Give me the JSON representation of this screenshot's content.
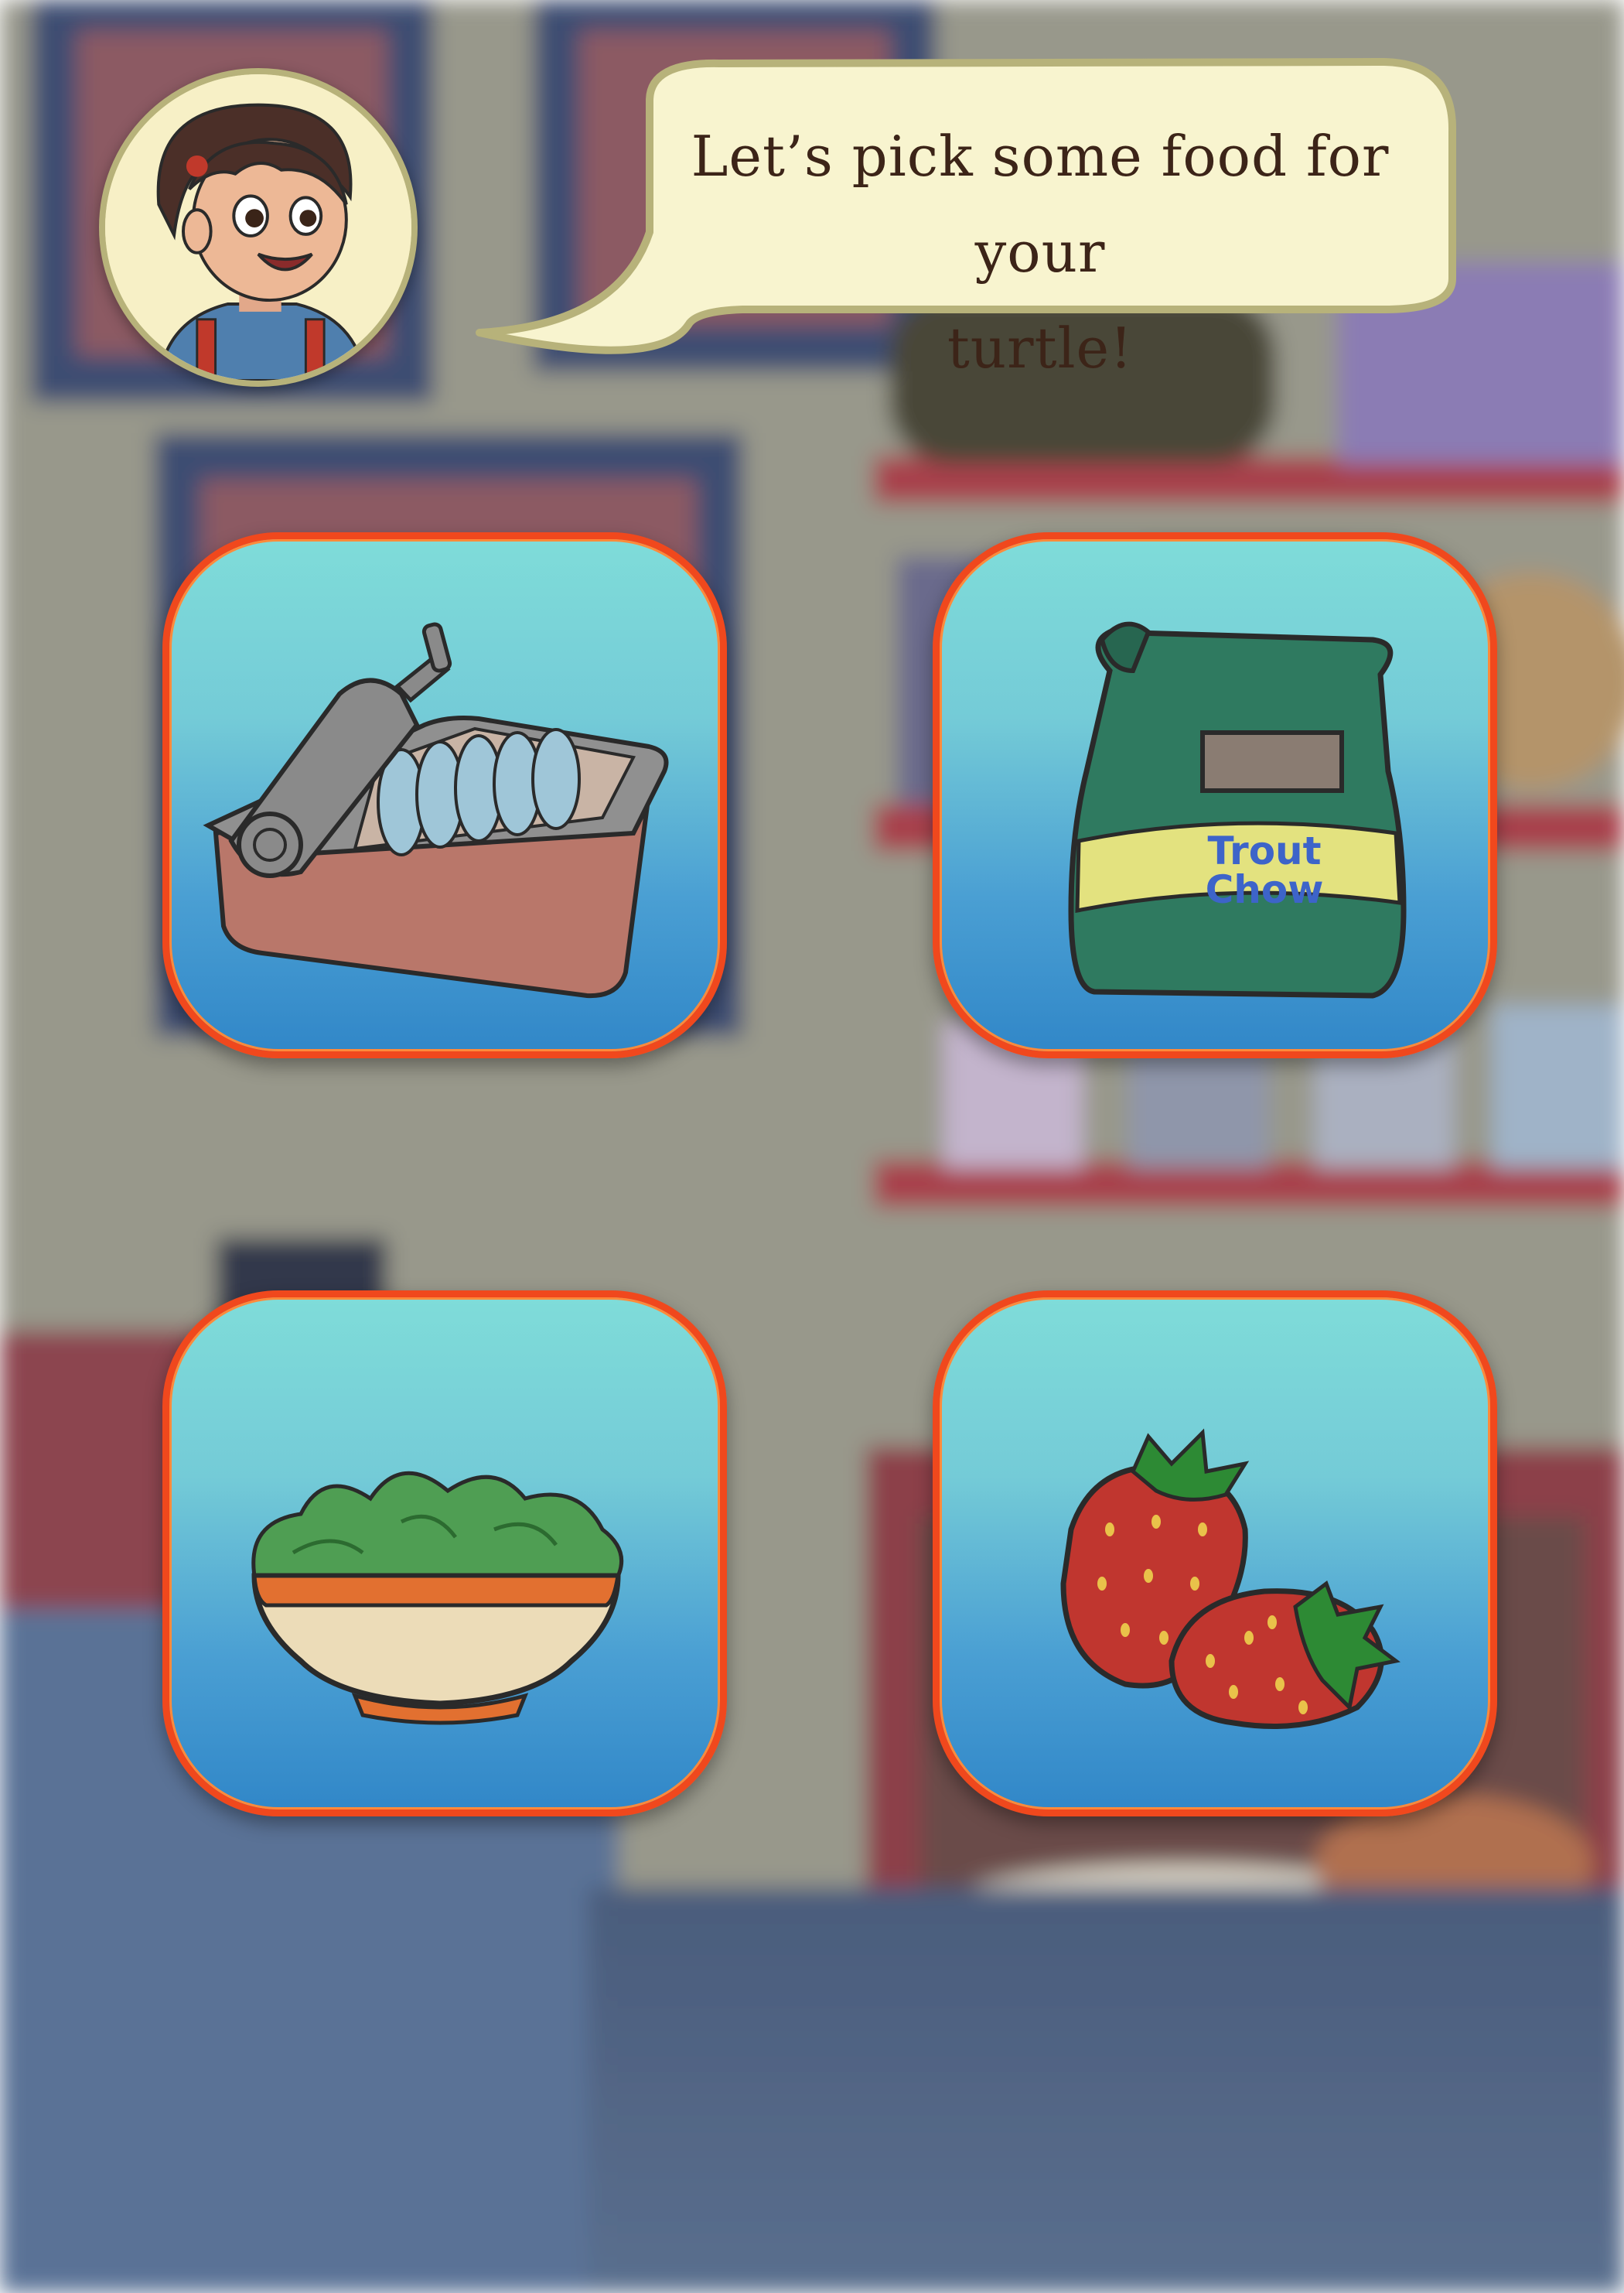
{
  "dialog": {
    "line1": "Let’s pick some food for your",
    "line2": "turtle!"
  },
  "food_options": [
    {
      "id": "sardines",
      "icon": "sardine-can-icon"
    },
    {
      "id": "trout_chow",
      "icon": "trout-chow-bag-icon",
      "bag_text_1": "Trout",
      "bag_text_2": "Chow"
    },
    {
      "id": "lettuce",
      "icon": "lettuce-bowl-icon"
    },
    {
      "id": "strawberries",
      "icon": "strawberries-icon"
    }
  ],
  "colors": {
    "card_border": "#f0481d",
    "card_top": "#7fdcd9",
    "card_bottom": "#3187c8",
    "bubble_fill": "#f8f4cf",
    "text": "#3c2418"
  }
}
